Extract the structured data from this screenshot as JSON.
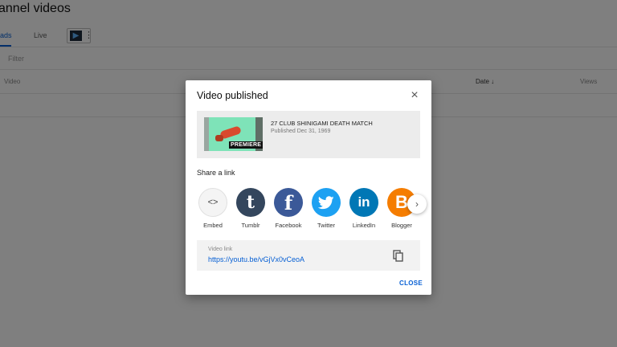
{
  "page": {
    "title": "annel videos",
    "tabs": [
      {
        "label": "ads"
      },
      {
        "label": "Live"
      }
    ],
    "filter_placeholder": "Filter",
    "columns": {
      "video": "Video",
      "date": "Date ↓",
      "views": "Views"
    }
  },
  "dialog": {
    "title": "Video published",
    "close_icon": "×",
    "video": {
      "title": "27 CLUB SHINIGAMI DEATH MATCH",
      "published": "Published Dec 31, 1969",
      "badge": "PREMIERE"
    },
    "share_label": "Share a link",
    "share_items": [
      {
        "name": "Embed",
        "glyph": "<>",
        "color": "#f4f4f4"
      },
      {
        "name": "Tumblr",
        "glyph": "t",
        "color": "#34465d"
      },
      {
        "name": "Facebook",
        "glyph": "f",
        "color": "#3b5998"
      },
      {
        "name": "Twitter",
        "glyph": "",
        "color": "#1da1f2"
      },
      {
        "name": "LinkedIn",
        "glyph": "in",
        "color": "#0077b5"
      },
      {
        "name": "Blogger",
        "glyph": "B",
        "color": "#f57d00"
      }
    ],
    "next_icon": "›",
    "link": {
      "label": "Video link",
      "url": "https://youtu.be/vGjVx0vCeoA"
    },
    "close_button": "CLOSE"
  },
  "colors": {
    "accent": "#065fd4",
    "overlay": "rgba(0,0,0,0.5)"
  }
}
